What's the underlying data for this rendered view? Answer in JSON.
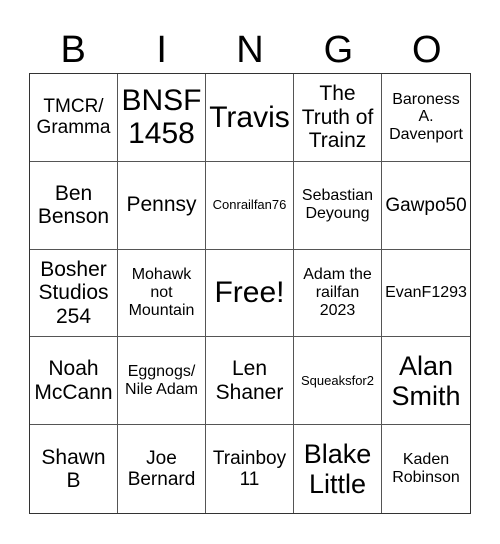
{
  "header": [
    "B",
    "I",
    "N",
    "G",
    "O"
  ],
  "cells": [
    "TMCR/ Gramma",
    "BNSF 1458",
    "Travis",
    "The Truth of Trainz",
    "Baroness A. Davenport",
    "Ben Benson",
    "Pennsy",
    "Conrailfan76",
    "Sebastian Deyoung",
    "Gawpo50",
    "Bosher Studios 254",
    "Mohawk not Mountain",
    "Free!",
    "Adam the railfan 2023",
    "EvanF1293",
    "Noah McCann",
    "Eggnogs/ Nile Adam",
    "Len Shaner",
    "Squeaksfor2",
    "Alan Smith",
    "Shawn B",
    "Joe Bernard",
    "Trainboy 11",
    "Blake Little",
    "Kaden Robinson"
  ]
}
